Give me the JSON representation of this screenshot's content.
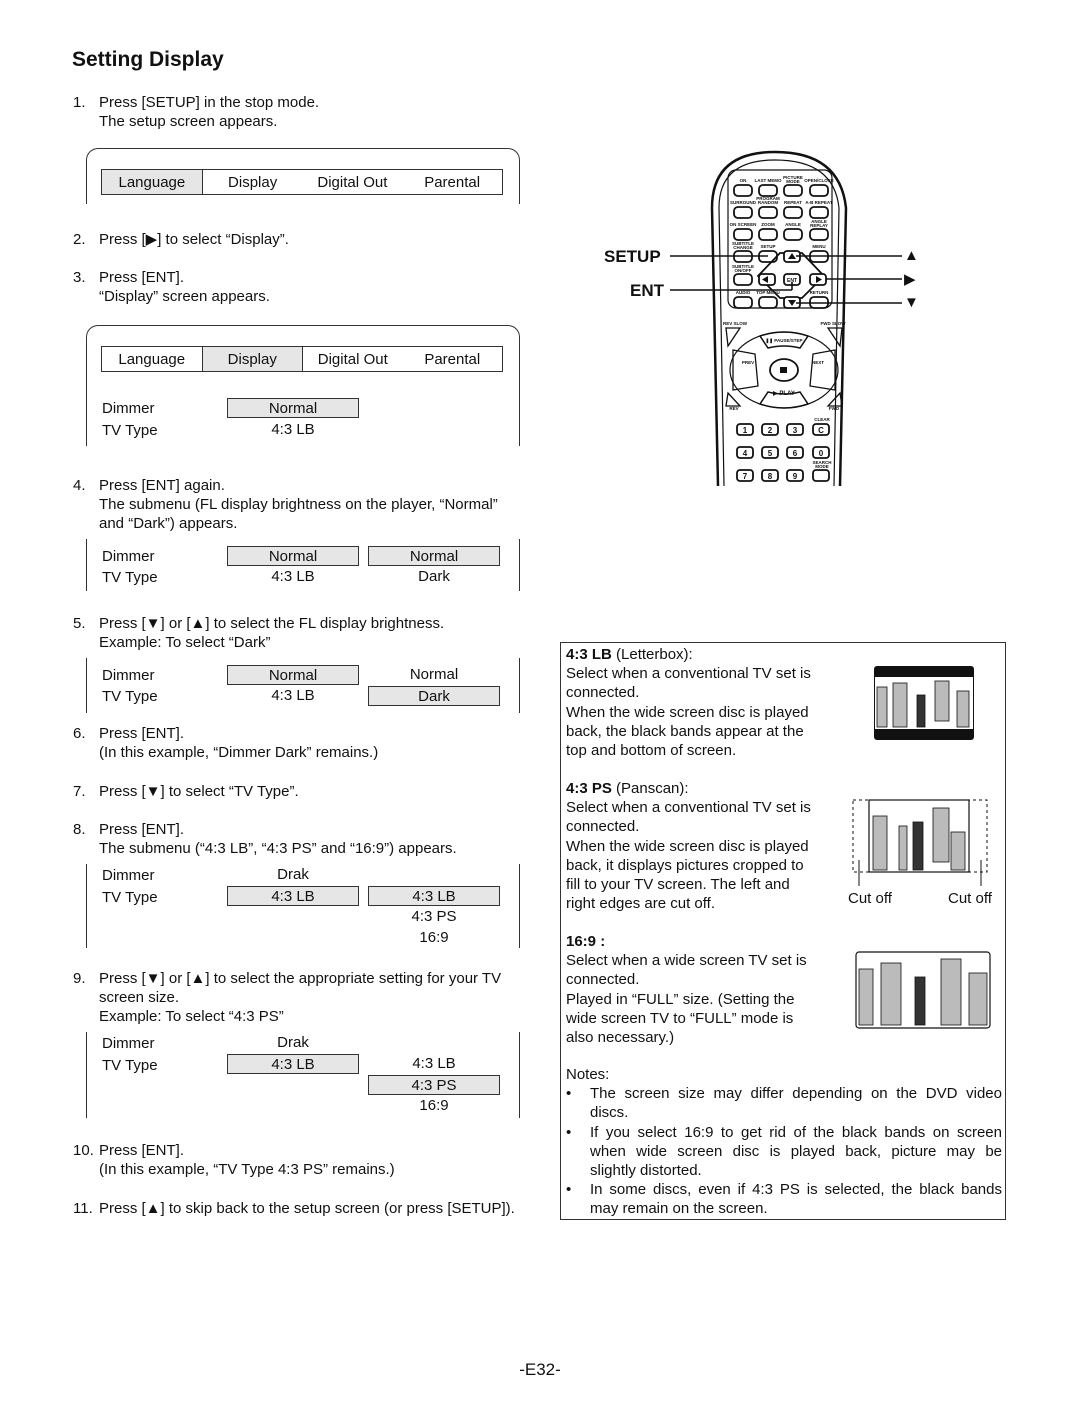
{
  "page": {
    "title": "Setting Display",
    "page_number": "-E32-"
  },
  "steps": [
    {
      "num": "1.",
      "lines": [
        "Press [SETUP] in the stop mode.",
        "The setup screen appears."
      ]
    },
    {
      "num": "2.",
      "lines": [
        "Press [▶] to select “Display”."
      ]
    },
    {
      "num": "3.",
      "lines": [
        "Press [ENT].",
        "“Display” screen appears."
      ]
    },
    {
      "num": "4.",
      "lines": [
        "Press [ENT] again.",
        "The submenu (FL display brightness on the player, “Normal”",
        "and “Dark”) appears."
      ]
    },
    {
      "num": "5.",
      "lines": [
        "Press [▼] or [▲] to select the FL display brightness.",
        "Example: To select “Dark”"
      ]
    },
    {
      "num": "6.",
      "lines": [
        "Press [ENT].",
        "(In this example, “Dimmer Dark” remains.)"
      ]
    },
    {
      "num": "7.",
      "lines": [
        "Press [▼] to select “TV Type”."
      ]
    },
    {
      "num": "8.",
      "lines": [
        "Press [ENT].",
        "The submenu (“4:3 LB”, “4:3 PS” and “16:9”) appears."
      ]
    },
    {
      "num": "9.",
      "lines": [
        "Press [▼] or [▲] to select the appropriate setting for your TV",
        "screen size.",
        "Example: To select “4:3 PS”"
      ]
    },
    {
      "num": "10.",
      "lines": [
        "Press [ENT].",
        "(In this example, “TV Type 4:3 PS” remains.)"
      ]
    },
    {
      "num": "11.",
      "lines": [
        "Press [▲] to skip back to the setup screen (or press [SETUP])."
      ]
    }
  ],
  "menu_tabs": [
    "Language",
    "Display",
    "Digital Out",
    "Parental"
  ],
  "screens": {
    "s1": {
      "selected_tab": "Language"
    },
    "s2": {
      "selected_tab": "Display",
      "dimmer": "Normal",
      "tvtype": "4:3 LB"
    },
    "s3": {
      "dimmer": "Normal",
      "tvtype": "4:3 LB",
      "sub": [
        "Normal",
        "Dark"
      ],
      "sub_selected": "Normal"
    },
    "s4": {
      "dimmer": "Normal",
      "tvtype": "4:3 LB",
      "sub": [
        "Normal",
        "Dark"
      ],
      "sub_selected": "Dark"
    },
    "s5": {
      "dimmer": "Drak",
      "tvtype": "4:3 LB",
      "sub": [
        "4:3 LB",
        "4:3 PS",
        "16:9"
      ],
      "sub_selected": "4:3 LB"
    },
    "s6": {
      "dimmer": "Drak",
      "tvtype": "4:3 LB",
      "sub": [
        "4:3 LB",
        "4:3 PS",
        "16:9"
      ],
      "sub_selected": "4:3 PS"
    }
  },
  "labels": {
    "dimmer": "Dimmer",
    "tvtype": "TV Type"
  },
  "remote": {
    "callouts": {
      "setup": "SETUP",
      "ent": "ENT",
      "up": "▲",
      "right": "▶",
      "down": "▼"
    },
    "buttons_row1": [
      "⏻/ON",
      "LAST MEMO",
      "PICTURE MODE",
      "OPEN/CLOSE"
    ],
    "buttons_row2": [
      "SURROUND",
      "PROGRAM RANDOM",
      "REPEAT",
      "A-B REPEAT"
    ],
    "buttons_row3": [
      "ON SCREEN",
      "ZOOM",
      "ANGLE",
      "ANGLE REPLAY"
    ],
    "buttons_row4": [
      "SUBTITLE CHANGE",
      "SETUP",
      "",
      "MENU"
    ],
    "buttons_row5": [
      "SUBTITLE ON/OFF",
      "",
      "ENT",
      ""
    ],
    "buttons_row6": [
      "AUDIO",
      "TOP MENU",
      "",
      "RETURN"
    ],
    "transport": {
      "rev_slow": "REV SLOW",
      "fwd_slow": "FWD SLOW",
      "pause": "❚❚ PAUSE/STEP",
      "prev": "PREV",
      "next": "NEXT",
      "play": "▶ PLAY",
      "rev": "REV",
      "fwd": "FWD",
      "clear": "CLEAR",
      "search_mode": "SEARCH MODE"
    },
    "numpad": [
      "1",
      "2",
      "3",
      "C",
      "4",
      "5",
      "6",
      "0",
      "7",
      "8",
      "9",
      ""
    ]
  },
  "notes_panel": {
    "lb": {
      "heading_bold": "4:3 LB",
      "heading_rest": " (Letterbox):",
      "lines": [
        "Select when a conventional TV set is",
        "connected.",
        "When the wide screen disc is played",
        "back, the black bands appear at the",
        "top and bottom of screen."
      ]
    },
    "ps": {
      "heading_bold": "4:3 PS",
      "heading_rest": " (Panscan):",
      "lines": [
        "Select when a conventional TV set is",
        "connected.",
        "When the wide screen disc is played",
        "back, it displays pictures cropped to",
        "fill to your TV screen. The left and",
        "right edges are cut off."
      ],
      "cut_left": "Cut off",
      "cut_right": "Cut off"
    },
    "wide": {
      "heading_bold": "16:9 :",
      "lines": [
        "Select when a wide screen TV set is",
        "connected.",
        "Played in “FULL” size. (Setting the",
        "wide screen TV to “FULL” mode is",
        "also necessary.)"
      ]
    },
    "notes_title": "Notes:",
    "notes": [
      [
        "The screen size may differ depending on the DVD video",
        "discs."
      ],
      [
        "If you select 16:9 to get rid of the black bands on screen",
        "when wide screen disc is played back, picture may be",
        "slightly distorted."
      ],
      [
        "In some discs, even if 4:3 PS is selected, the black bands",
        "may remain on the screen."
      ]
    ]
  }
}
